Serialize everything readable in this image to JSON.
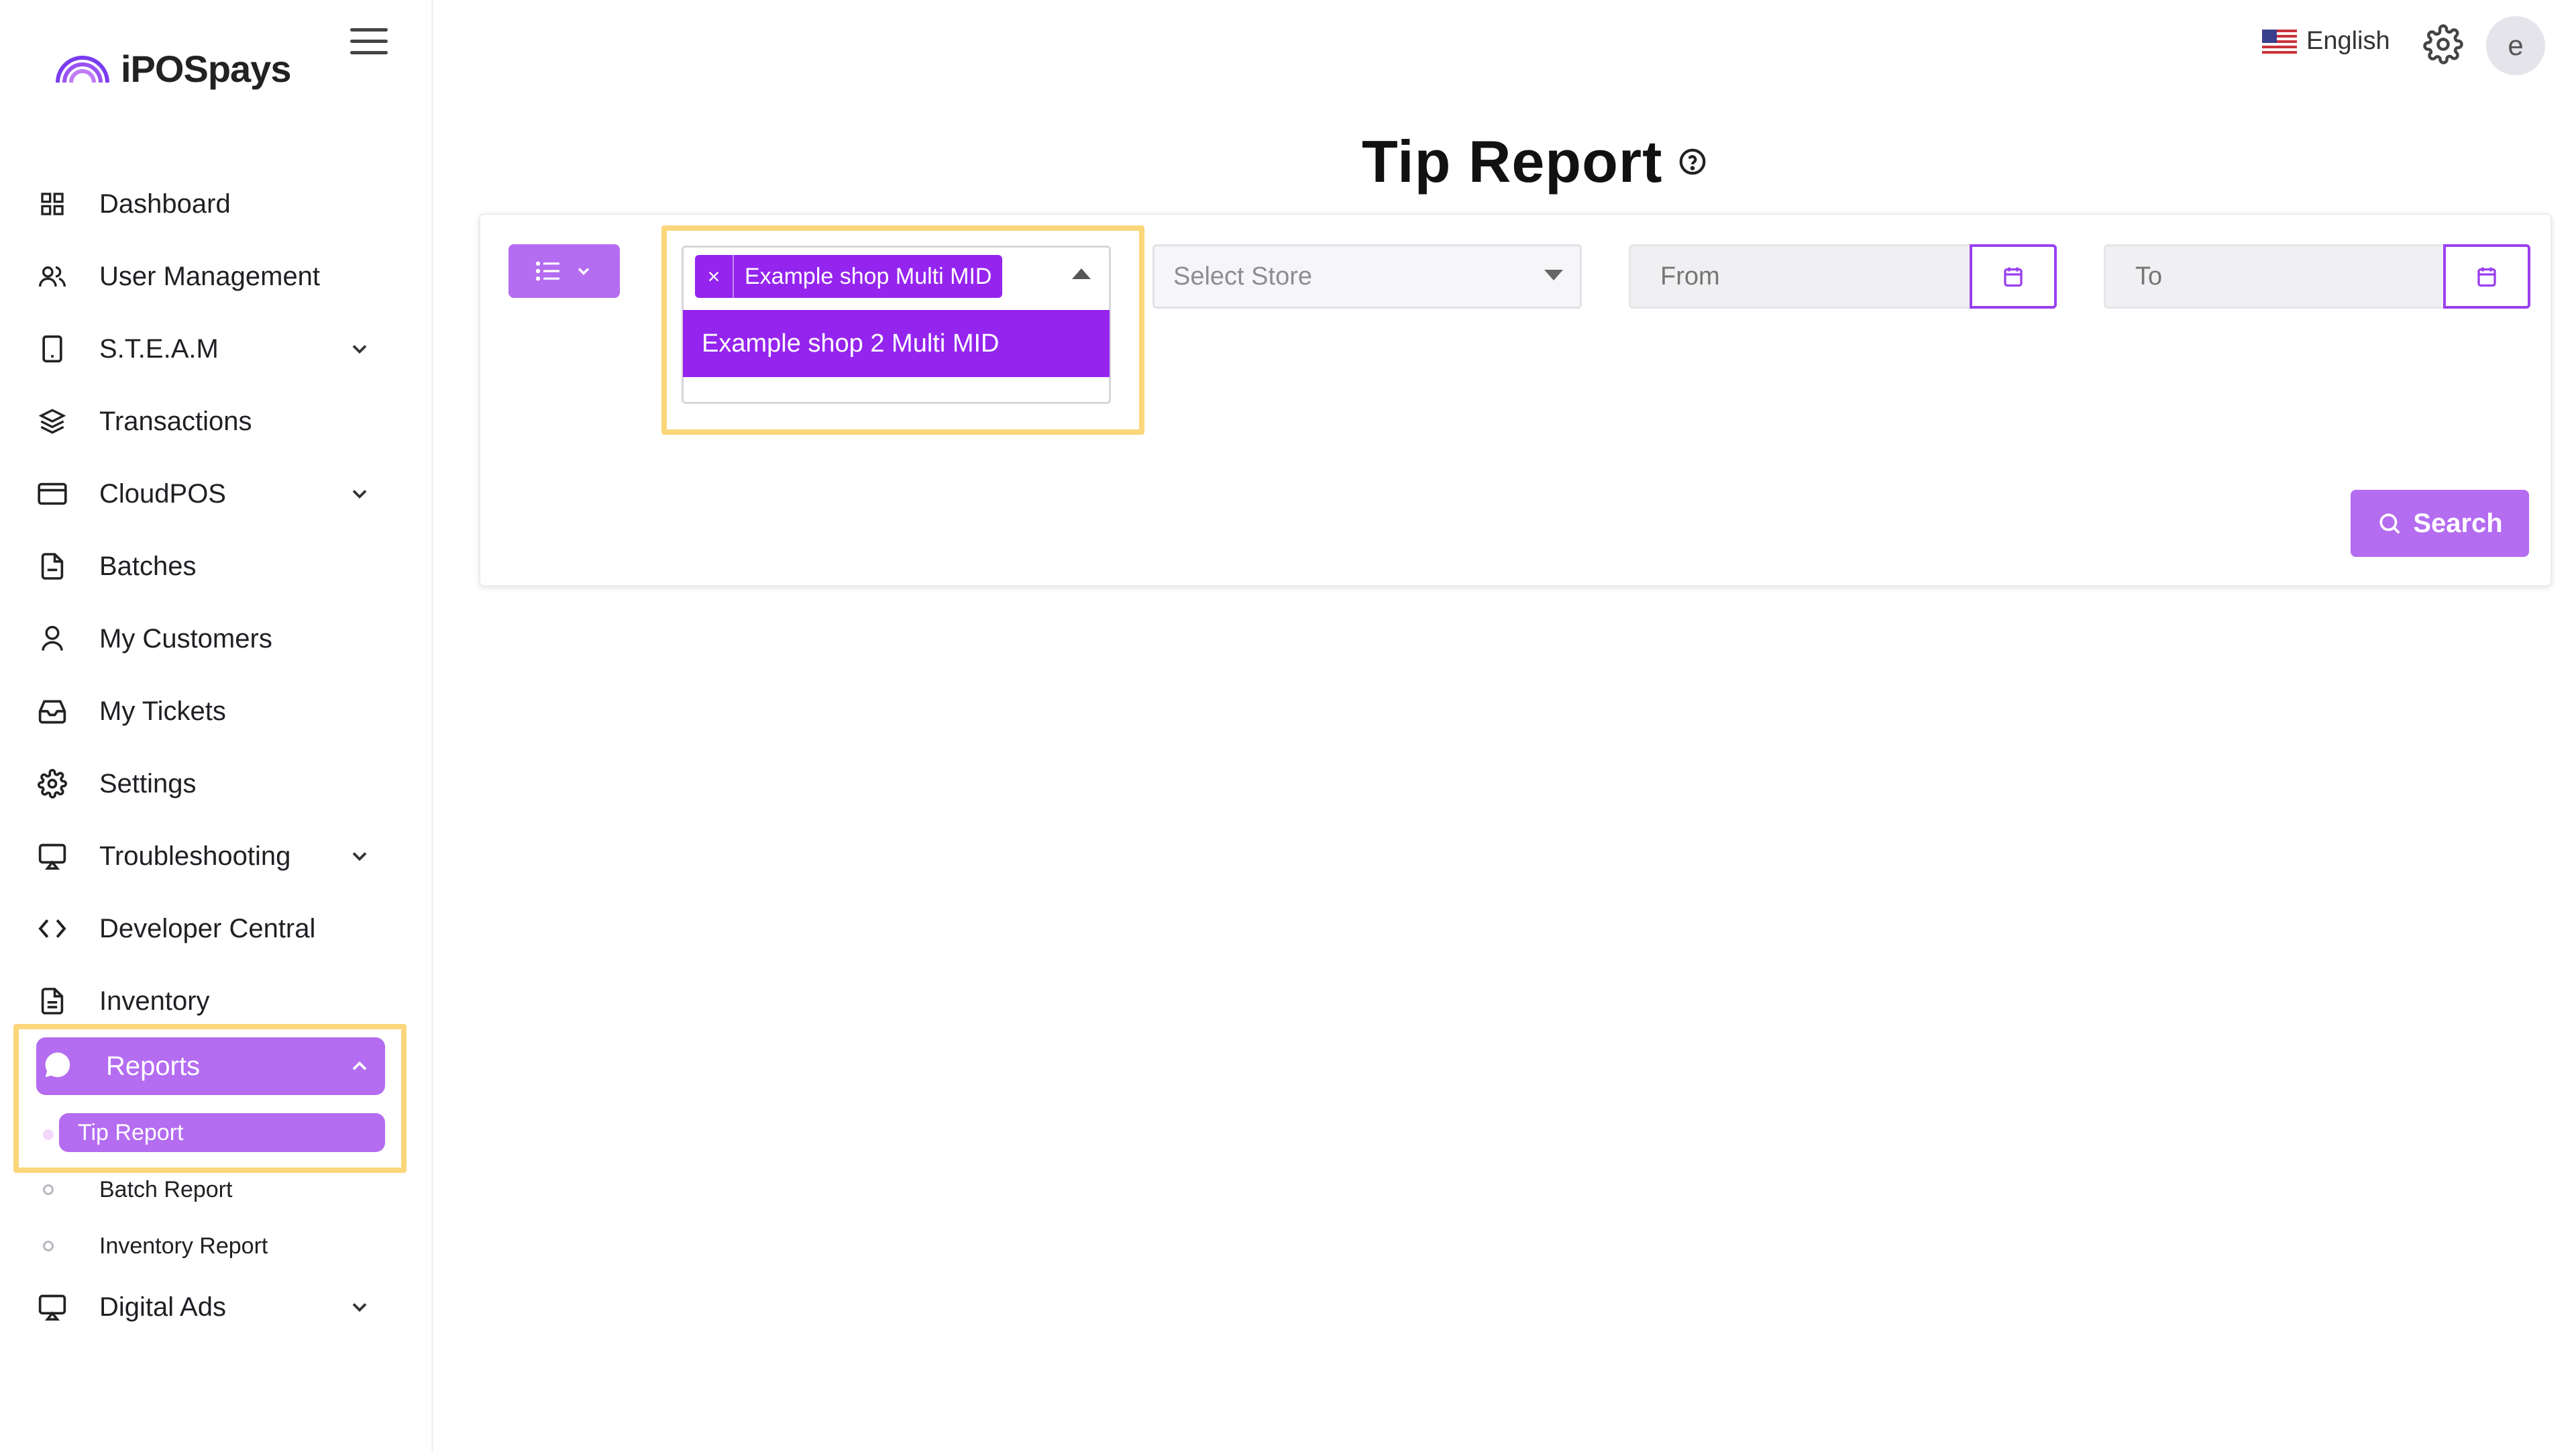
{
  "app": {
    "brand": "iPOSpays"
  },
  "header": {
    "language": "English",
    "avatar_initial": "e"
  },
  "sidebar": {
    "items": [
      {
        "label": "Dashboard",
        "icon": "grid-icon"
      },
      {
        "label": "User Management",
        "icon": "users-icon"
      },
      {
        "label": "S.T.E.A.M",
        "icon": "device-icon",
        "expandable": true
      },
      {
        "label": "Transactions",
        "icon": "layers-icon"
      },
      {
        "label": "CloudPOS",
        "icon": "card-icon",
        "expandable": true
      },
      {
        "label": "Batches",
        "icon": "file-icon"
      },
      {
        "label": "My Customers",
        "icon": "person-icon"
      },
      {
        "label": "My Tickets",
        "icon": "inbox-icon"
      },
      {
        "label": "Settings",
        "icon": "gear-icon"
      },
      {
        "label": "Troubleshooting",
        "icon": "monitor-icon",
        "expandable": true
      },
      {
        "label": "Developer Central",
        "icon": "code-icon"
      },
      {
        "label": "Inventory",
        "icon": "document-icon"
      }
    ],
    "reports": {
      "label": "Reports",
      "icon": "chat-icon",
      "sub_items": [
        {
          "label": "Tip Report",
          "active": true
        },
        {
          "label": "Batch Report",
          "active": false
        },
        {
          "label": "Inventory Report",
          "active": false
        }
      ]
    },
    "digital_ads": {
      "label": "Digital Ads",
      "icon": "monitor-icon"
    }
  },
  "main": {
    "title": "Tip Report",
    "filters": {
      "merchant_tag": "Example shop Multi MID",
      "merchant_option": "Example shop 2 Multi MID",
      "store_placeholder": "Select Store",
      "from_placeholder": "From",
      "to_placeholder": "To"
    },
    "search_label": "Search"
  },
  "colors": {
    "accent": "#b46cf0",
    "accent_dark": "#9524ee",
    "highlight": "#fbd67a"
  }
}
